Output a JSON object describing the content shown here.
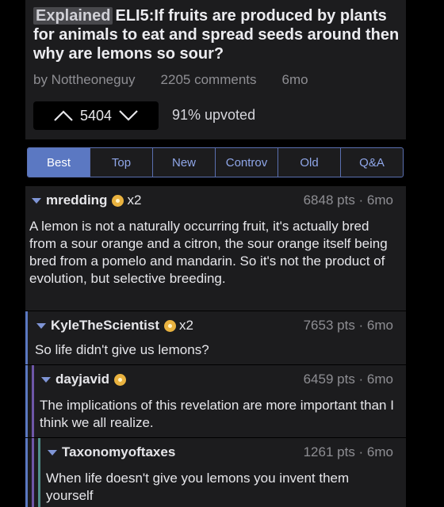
{
  "post": {
    "flair": "Explained",
    "title": "ELI5:If fruits are produced by plants for animals to eat and spread seeds around then why are lemons so sour?",
    "author": "by Nottheoneguy",
    "comments": "2205 comments",
    "age": "6mo",
    "score": "5404",
    "upvoted": "91% upvoted"
  },
  "sort_tabs": [
    {
      "label": "Best",
      "active": true
    },
    {
      "label": "Top"
    },
    {
      "label": "New"
    },
    {
      "label": "Controv"
    },
    {
      "label": "Old"
    },
    {
      "label": "Q&A"
    }
  ],
  "comments": [
    {
      "author": "mredding",
      "awards": "x2",
      "score": "6848 pts · 6mo",
      "body": "A lemon is not a naturally occurring fruit, it's actually bred from a sour orange and a citron, the sour orange itself being bred from a pomelo and mandarin. So it's not the product of evolution, but selective breeding."
    },
    {
      "author": "KyleTheScientist",
      "awards": "x2",
      "score": "7653 pts · 6mo",
      "body": "So life didn't give us lemons?"
    },
    {
      "author": "dayjavid",
      "awards": "",
      "score": "6459 pts · 6mo",
      "body": "The implications of this revelation are more important than I think we all realize."
    },
    {
      "author": "Taxonomyoftaxes",
      "awards": "",
      "score": "1261 pts · 6mo",
      "body": "When life doesn't give you lemons you invent them yourself"
    }
  ],
  "colors": {
    "accent": "#5b78c2",
    "thread_line_1": "#5b78c2",
    "thread_line_2": "#6e56a8",
    "thread_line_3": "#4f8f8a",
    "award": "#e9b23f"
  }
}
